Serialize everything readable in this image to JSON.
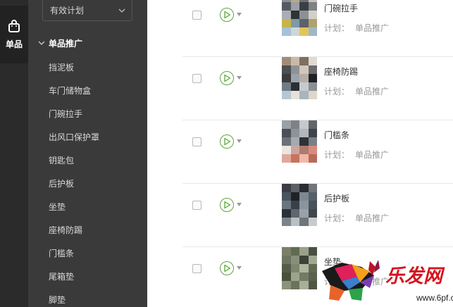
{
  "rail": {
    "label": "单品",
    "icon": "shopping-bag-icon"
  },
  "sidebar": {
    "plan_select": "有效计划",
    "group_label": "单品推广",
    "items": [
      {
        "label": "挡泥板"
      },
      {
        "label": "车门储物盒"
      },
      {
        "label": "门碗拉手"
      },
      {
        "label": "出风口保护罩"
      },
      {
        "label": "钥匙包"
      },
      {
        "label": "后护板"
      },
      {
        "label": "坐垫"
      },
      {
        "label": "座椅防踢"
      },
      {
        "label": "门槛条"
      },
      {
        "label": "尾箱垫"
      },
      {
        "label": "脚垫"
      }
    ]
  },
  "list": {
    "rows": [
      {
        "title": "门碗拉手",
        "plan_prefix": "计划：",
        "plan_name": "单品推广"
      },
      {
        "title": "座椅防踢",
        "plan_prefix": "计划：",
        "plan_name": "单品推广"
      },
      {
        "title": "门槛条",
        "plan_prefix": "计划：",
        "plan_name": "单品推广"
      },
      {
        "title": "后护板",
        "plan_prefix": "计划：",
        "plan_name": "单品推广"
      },
      {
        "title": "坐垫",
        "plan_prefix": "计划：",
        "plan_name": "单品推广"
      }
    ]
  },
  "watermark": {
    "brand": "乐发网",
    "url": "www.6pf.cn"
  },
  "colors": {
    "rail_bg": "#2b2b2b",
    "sidebar_bg": "#3a3a3a",
    "play_green": "#5aa83a",
    "watermark_red": "#d6131e"
  }
}
